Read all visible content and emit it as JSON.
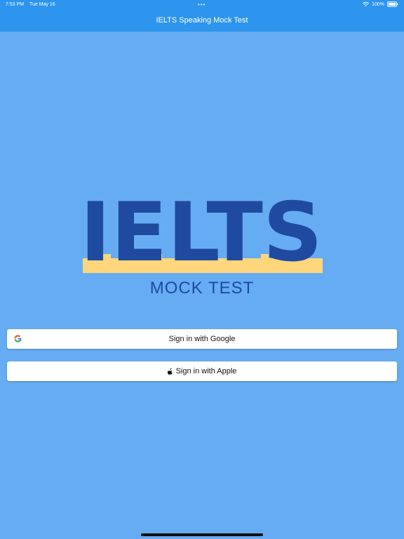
{
  "status_bar": {
    "time": "7:53 PM",
    "date": "Tue May 16",
    "dots": "•••",
    "battery_percent": "100%"
  },
  "app": {
    "title": "IELTS Speaking Mock Test"
  },
  "logo": {
    "title": "IELTS",
    "subtitle": "MOCK TEST"
  },
  "auth": {
    "google_label": "Sign in with Google",
    "apple_label": "Sign in with Apple"
  },
  "colors": {
    "background": "#66acf3",
    "header": "#2d95ee",
    "logo_blue": "#1f4aa0",
    "logo_yellow": "#ffd67c",
    "button_background": "#ffffff"
  },
  "icons": {
    "status": [
      "wifi-icon",
      "battery-icon"
    ],
    "auth": [
      "google-icon",
      "apple-icon"
    ]
  }
}
